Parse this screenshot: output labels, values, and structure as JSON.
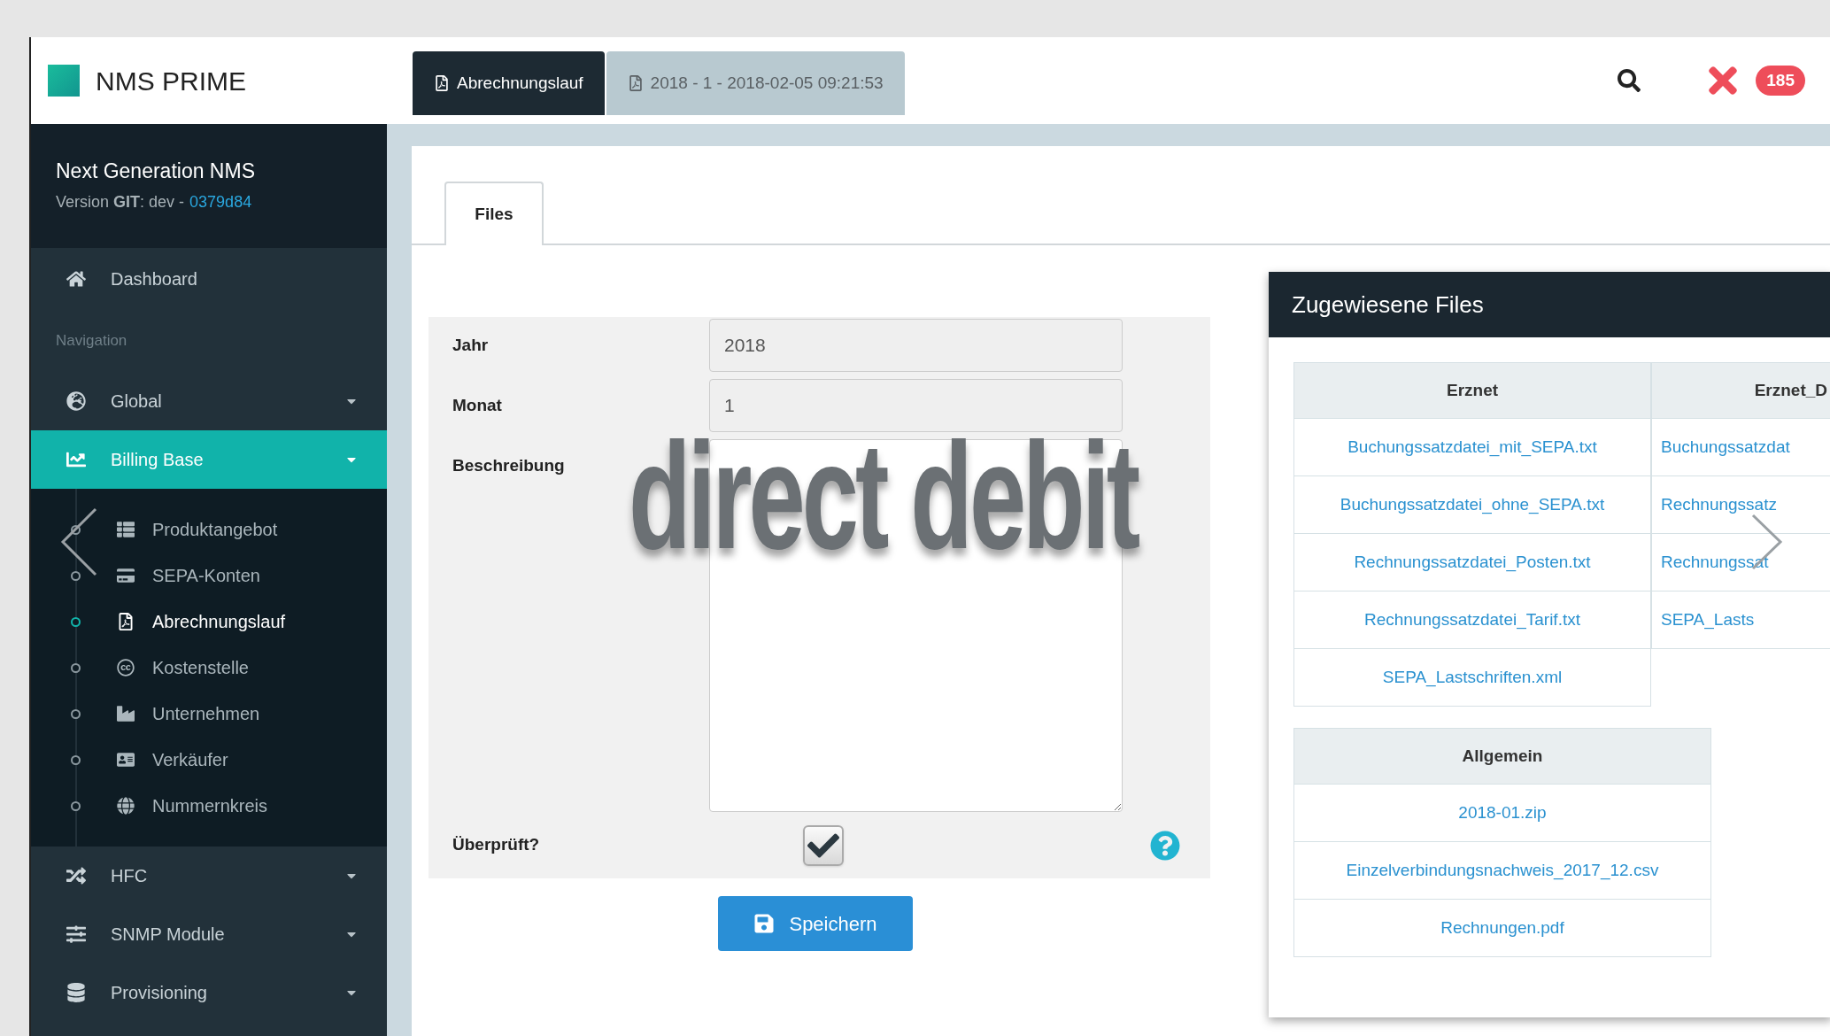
{
  "app": {
    "logo_text": "NMS PRIME"
  },
  "tabs": [
    {
      "label": "Abrechnungslauf",
      "selected": true
    },
    {
      "label": "2018 - 1 - 2018-02-05 09:21:53",
      "selected": false
    }
  ],
  "header": {
    "notification_count": "185"
  },
  "sidebar": {
    "title": "Next Generation NMS",
    "version": "Version **GIT**: dev -",
    "commit": "0379d84",
    "items": [
      {
        "kind": "link",
        "label": "Dashboard"
      },
      {
        "kind": "section",
        "label": "Navigation"
      },
      {
        "kind": "group",
        "label": "Global",
        "selected": false,
        "expanded": false
      },
      {
        "kind": "group",
        "label": "Billing Base",
        "selected": true,
        "expanded": true,
        "children": [
          {
            "label": "Produktangebot",
            "selected": false
          },
          {
            "label": "SEPA-Konten",
            "selected": false
          },
          {
            "label": "Abrechnungslauf",
            "selected": true
          },
          {
            "label": "Kostenstelle",
            "selected": false
          },
          {
            "label": "Unternehmen",
            "selected": false
          },
          {
            "label": "Verkäufer",
            "selected": false
          },
          {
            "label": "Nummernkreis",
            "selected": false
          }
        ]
      },
      {
        "kind": "group",
        "label": "HFC",
        "selected": false,
        "expanded": false
      },
      {
        "kind": "group",
        "label": "SNMP Module",
        "selected": false,
        "expanded": false
      },
      {
        "kind": "group",
        "label": "Provisioning",
        "selected": false,
        "expanded": false
      }
    ]
  },
  "page_tabs": [
    {
      "label": "Files",
      "selected": true
    }
  ],
  "form": {
    "fields": [
      {
        "kind": "input",
        "label": "Jahr",
        "value": "2018"
      },
      {
        "kind": "input",
        "label": "Monat",
        "value": "1"
      },
      {
        "kind": "textarea",
        "label": "Beschreibung"
      },
      {
        "kind": "checkbox",
        "label": "Überprüft?",
        "checked": true
      }
    ],
    "submit": "Speichern"
  },
  "files_panel": {
    "title": "Zugewiesene Files",
    "tables": [
      {
        "columns": [
          "Erznet",
          "Erznet_D"
        ],
        "rows": [
          [
            "Buchungssatzdatei_mit_SEPA.txt",
            "Buchungssatzdat"
          ],
          [
            "Buchungssatzdatei_ohne_SEPA.txt",
            "Rechnungssatz"
          ],
          [
            "Rechnungssatzdatei_Posten.txt",
            "Rechnungssat"
          ],
          [
            "Rechnungssatzdatei_Tarif.txt",
            "SEPA_Lasts"
          ],
          [
            "SEPA_Lastschriften.xml"
          ]
        ]
      },
      {
        "columns": [
          "Allgemein"
        ],
        "rows": [
          [
            "2018-01.zip"
          ],
          [
            "Einzelverbindungsnachweis_2017_12.csv"
          ],
          [
            "Rechnungen.pdf"
          ]
        ]
      }
    ]
  },
  "overlay_caption": "direct debit"
}
